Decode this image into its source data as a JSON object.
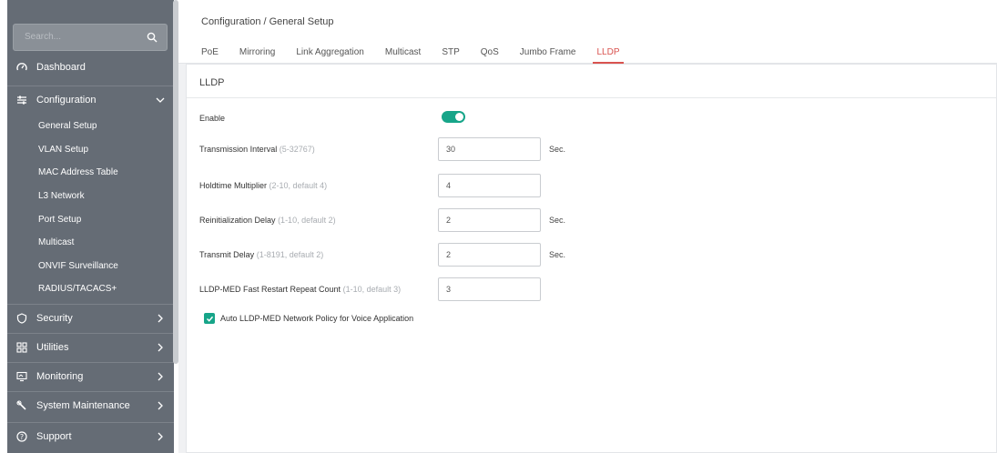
{
  "search": {
    "placeholder": "Search..."
  },
  "sidebar": {
    "items": [
      {
        "label": "Dashboard",
        "icon": "dashboard-icon"
      },
      {
        "label": "Configuration",
        "icon": "sliders-icon"
      },
      {
        "label": "Security",
        "icon": "shield-icon"
      },
      {
        "label": "Utilities",
        "icon": "grid-icon"
      },
      {
        "label": "Monitoring",
        "icon": "monitor-icon"
      },
      {
        "label": "System Maintenance",
        "icon": "wrench-icon"
      },
      {
        "label": "Support",
        "icon": "help-icon"
      }
    ],
    "sub_items": [
      "General Setup",
      "VLAN Setup",
      "MAC Address Table",
      "L3 Network",
      "Port Setup",
      "Multicast",
      "ONVIF Surveillance",
      "RADIUS/TACACS+"
    ]
  },
  "header": {
    "breadcrumb": "Configuration /  General Setup",
    "tabs": [
      "PoE",
      "Mirroring",
      "Link Aggregation",
      "Multicast",
      "STP",
      "QoS",
      "Jumbo Frame",
      "LLDP"
    ],
    "active_tab": "LLDP"
  },
  "panel": {
    "title": "LLDP",
    "enable_label": "Enable",
    "enable_state": true,
    "fields": [
      {
        "label": "Transmission Interval",
        "hint": "(5-32767)",
        "value": "30",
        "unit": "Sec."
      },
      {
        "label": "Holdtime Multiplier",
        "hint": "(2-10, default 4)",
        "value": "4",
        "unit": ""
      },
      {
        "label": "Reinitialization Delay",
        "hint": "(1-10, default 2)",
        "value": "2",
        "unit": "Sec."
      },
      {
        "label": "Transmit Delay",
        "hint": "(1-8191, default 2)",
        "value": "2",
        "unit": "Sec."
      },
      {
        "label": "LLDP-MED Fast Restart Repeat Count",
        "hint": "(1-10, default 3)",
        "value": "3",
        "unit": ""
      }
    ],
    "checkbox_label": "Auto LLDP-MED Network Policy for Voice Application",
    "checkbox_checked": true
  },
  "colors": {
    "sidebar": "#656c75",
    "accent": "#17a589",
    "active_tab": "#d9534f"
  }
}
